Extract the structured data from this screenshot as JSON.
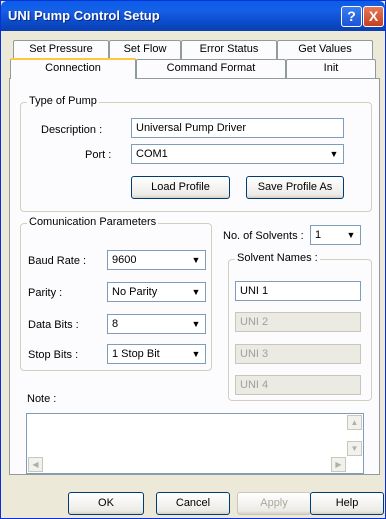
{
  "window": {
    "title": "UNI Pump Control Setup"
  },
  "title_buttons": {
    "help": "?",
    "close": "X"
  },
  "tabs": {
    "row1": [
      "Set Pressure Limits",
      "Set Flow",
      "Error Status",
      "Get Values"
    ],
    "row2": [
      "Connection",
      "Command Format",
      "Init"
    ],
    "active": "Connection"
  },
  "pump_type": {
    "group_label": "Type of Pump",
    "description_label": "Description :",
    "description_value": "Universal Pump Driver",
    "port_label": "Port :",
    "port_value": "COM1",
    "load_button": "Load Profile",
    "save_button": "Save Profile As"
  },
  "comm": {
    "group_label": "Comunication Parameters",
    "baud_label": "Baud Rate :",
    "baud_value": "9600",
    "parity_label": "Parity :",
    "parity_value": "No Parity",
    "databits_label": "Data Bits :",
    "databits_value": "8",
    "stopbits_label": "Stop Bits :",
    "stopbits_value": "1 Stop Bit"
  },
  "solvents": {
    "count_label": "No. of Solvents :",
    "count_value": "1",
    "group_label": "Solvent Names :",
    "names": [
      "UNI 1",
      "UNI 2",
      "UNI 3",
      "UNI 4"
    ]
  },
  "note": {
    "label": "Note :",
    "value": ""
  },
  "buttons": {
    "ok": "OK",
    "cancel": "Cancel",
    "apply": "Apply",
    "help": "Help"
  },
  "icons": {
    "dropdown": "chevron-down-icon",
    "scroll_up": "triangle-up-icon",
    "scroll_down": "triangle-down-icon",
    "scroll_left": "triangle-left-icon",
    "scroll_right": "triangle-right-icon"
  }
}
